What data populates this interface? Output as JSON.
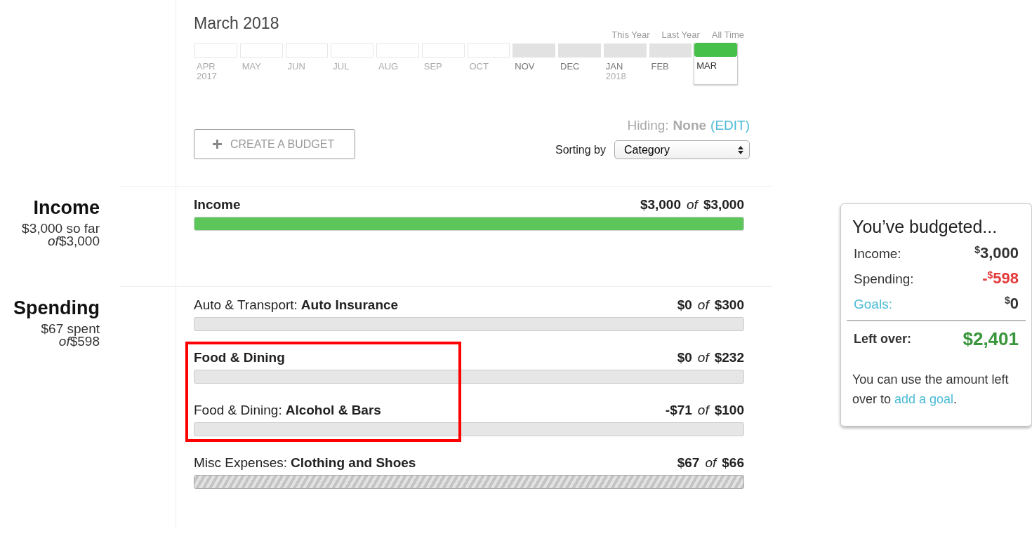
{
  "header": {
    "title": "March 2018",
    "ranges": [
      "This Year",
      "Last Year",
      "All Time"
    ]
  },
  "months": [
    {
      "label": "APR",
      "year": "2017",
      "has_data": false,
      "selected": false
    },
    {
      "label": "MAY",
      "has_data": false,
      "selected": false
    },
    {
      "label": "JUN",
      "has_data": false,
      "selected": false
    },
    {
      "label": "JUL",
      "has_data": false,
      "selected": false
    },
    {
      "label": "AUG",
      "has_data": false,
      "selected": false
    },
    {
      "label": "SEP",
      "has_data": false,
      "selected": false
    },
    {
      "label": "OCT",
      "has_data": false,
      "selected": false
    },
    {
      "label": "NOV",
      "has_data": true,
      "selected": false
    },
    {
      "label": "DEC",
      "has_data": true,
      "selected": false
    },
    {
      "label": "JAN",
      "year": "2018",
      "has_data": true,
      "selected": false
    },
    {
      "label": "FEB",
      "has_data": true,
      "selected": false
    },
    {
      "label": "MAR",
      "has_data": true,
      "selected": true
    }
  ],
  "hiding": {
    "label": "Hiding:",
    "value": "None",
    "edit": "(EDIT)"
  },
  "create_button": {
    "label": "CREATE A BUDGET"
  },
  "sorting": {
    "label": "Sorting by",
    "value": "Category"
  },
  "sections": [
    {
      "title": "Income",
      "summary": "$3,000 so far",
      "total": "*of*$3,000",
      "rows": [
        {
          "name": "Income",
          "amount": "$3,000",
          "of": "of",
          "total": "$3,000",
          "level": 1,
          "over": false,
          "highlighted": false
        }
      ]
    },
    {
      "title": "Spending",
      "summary": "$67 spent",
      "total": "*of*$598",
      "rows": [
        {
          "category": "Auto & Transport:",
          "name": "Auto Insurance",
          "amount": "$0",
          "of": "of",
          "total": "$300",
          "level": 0,
          "over": false,
          "highlighted": false
        },
        {
          "name": "Food & Dining",
          "amount": "$0",
          "of": "of",
          "total": "$232",
          "level": 0,
          "over": false,
          "highlighted": true
        },
        {
          "category": "Food & Dining:",
          "name": "Alcohol & Bars",
          "amount": "-$71",
          "of": "of",
          "total": "$100",
          "level": 0,
          "over": false,
          "highlighted": true
        },
        {
          "category": "Misc Expenses:",
          "name": "Clothing and Shoes",
          "amount": "$67",
          "of": "of",
          "total": "$66",
          "level": 1,
          "over": true,
          "highlighted": false
        }
      ]
    }
  ],
  "card": {
    "title": "You’ve budgeted...",
    "lines": [
      {
        "label": "Income:",
        "kind": "plain",
        "negative": false,
        "currency": "$",
        "value": "3,000"
      },
      {
        "label": "Spending:",
        "kind": "plain",
        "negative": true,
        "sign": "-",
        "currency": "$",
        "value": "598"
      },
      {
        "label": "Goals:",
        "kind": "link",
        "negative": false,
        "currency": "$",
        "value": "0"
      }
    ],
    "left_over": {
      "label": "Left over:",
      "value": "$2,401"
    },
    "note": "You can use the amount left over to ",
    "note_link": "add a goal",
    "note_end": "."
  }
}
